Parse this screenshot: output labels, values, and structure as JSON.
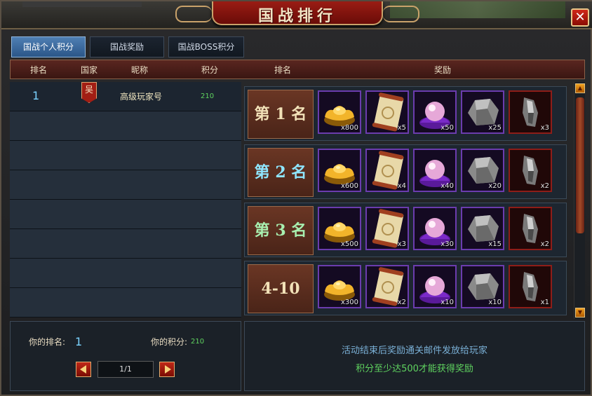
{
  "window": {
    "title": "国战排行",
    "close_glyph": "✕"
  },
  "tabs": [
    {
      "label": "国战个人积分",
      "active": true
    },
    {
      "label": "国战奖励",
      "active": false
    },
    {
      "label": "国战BOSS积分",
      "active": false
    }
  ],
  "columns": {
    "rank": "排名",
    "country": "国家",
    "nickname": "昵称",
    "score": "积分",
    "reward_rank": "排名",
    "reward": "奖励"
  },
  "ranking": [
    {
      "rank": "1",
      "country": "吴",
      "nickname": "高级玩家号",
      "score": "210"
    }
  ],
  "rewards": [
    {
      "label": "第 1 名",
      "label_color": "#f2e2b8",
      "items": [
        {
          "icon": "gold-ingot-icon",
          "count": "x800"
        },
        {
          "icon": "scroll-icon",
          "count": "x5"
        },
        {
          "icon": "pink-pearl-icon",
          "count": "x50"
        },
        {
          "icon": "stone-icon",
          "count": "x25"
        },
        {
          "icon": "iron-ore-icon",
          "count": "x3"
        }
      ]
    },
    {
      "label": "第 2 名",
      "label_color": "#8fe6ff",
      "items": [
        {
          "icon": "gold-ingot-icon",
          "count": "x600"
        },
        {
          "icon": "scroll-icon",
          "count": "x4"
        },
        {
          "icon": "pink-pearl-icon",
          "count": "x40"
        },
        {
          "icon": "stone-icon",
          "count": "x20"
        },
        {
          "icon": "iron-ore-icon",
          "count": "x2"
        }
      ]
    },
    {
      "label": "第 3 名",
      "label_color": "#a8f0b0",
      "items": [
        {
          "icon": "gold-ingot-icon",
          "count": "x500"
        },
        {
          "icon": "scroll-icon",
          "count": "x3"
        },
        {
          "icon": "pink-pearl-icon",
          "count": "x30"
        },
        {
          "icon": "stone-icon",
          "count": "x15"
        },
        {
          "icon": "iron-ore-icon",
          "count": "x2"
        }
      ]
    },
    {
      "label": "4-10",
      "label_color": "#f2e2b8",
      "items": [
        {
          "icon": "gold-ingot-icon",
          "count": "x300"
        },
        {
          "icon": "scroll-icon",
          "count": "x2"
        },
        {
          "icon": "pink-pearl-icon",
          "count": "x10"
        },
        {
          "icon": "stone-icon",
          "count": "x10"
        },
        {
          "icon": "iron-ore-icon",
          "count": "x1"
        }
      ]
    }
  ],
  "footer": {
    "my_rank_label": "你的排名:",
    "my_rank": "1",
    "my_score_label": "你的积分:",
    "my_score": "210",
    "page": "1/1",
    "notice1": "活动结束后奖励通关邮件发放给玩家",
    "notice2": "积分至少达500才能获得奖励"
  }
}
